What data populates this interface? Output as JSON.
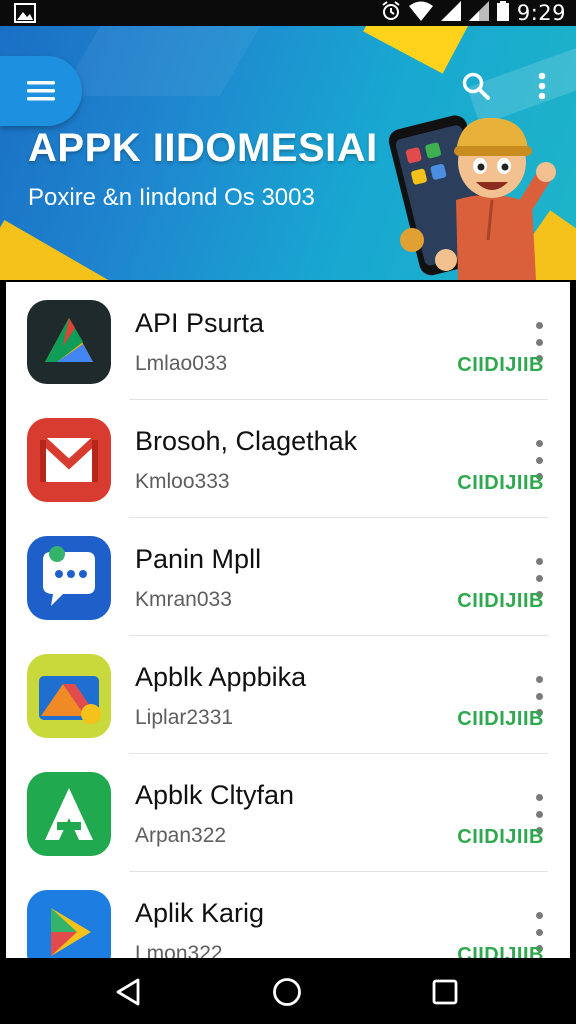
{
  "status_bar": {
    "time": "9:29",
    "icons": [
      "image-icon",
      "alarm-icon",
      "wifi-icon",
      "signal-icon",
      "battery-icon"
    ]
  },
  "header": {
    "title": "APPK IIDOMESIAI",
    "subtitle": "Poxire &n Iindond Os 3003",
    "menu_icon": "hamburger-menu-icon",
    "search_icon": "search-icon",
    "more_icon": "more-vert-icon",
    "colors": {
      "accent_blue": "#1e90e0",
      "accent_yellow": "#f4c21a"
    }
  },
  "apps": [
    {
      "title": "API Psurta",
      "subtitle": "Lmlao033",
      "action": "CIIDIJIIB",
      "icon": "triangle-logo-icon"
    },
    {
      "title": "Brosoh, Clagethak",
      "subtitle": "Kmloo333",
      "action": "CIIDIJIIB",
      "icon": "mail-m-icon"
    },
    {
      "title": "Panin Mpll",
      "subtitle": "Kmran033",
      "action": "CIIDIJIIB",
      "icon": "chat-bubble-icon"
    },
    {
      "title": "Apblk Appbika",
      "subtitle": "Liplar2331",
      "action": "CIIDIJIIB",
      "icon": "folder-triangle-icon"
    },
    {
      "title": "Apblk Cltyfan",
      "subtitle": "Arpan322",
      "action": "CIIDIJIIB",
      "icon": "letter-a-icon"
    },
    {
      "title": "Aplik Karig",
      "subtitle": "Lmon322",
      "action": "CIIDIJIIB",
      "icon": "play-triangle-icon"
    }
  ],
  "nav": {
    "back_icon": "back-triangle-icon",
    "home_icon": "home-circle-icon",
    "recents_icon": "recents-square-icon"
  }
}
